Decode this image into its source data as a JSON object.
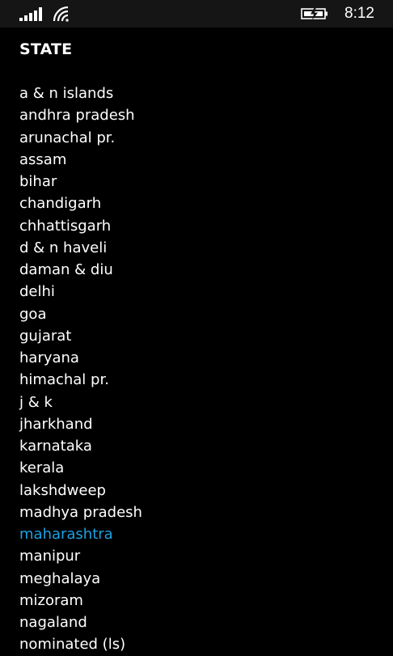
{
  "status_bar": {
    "time": "8:12",
    "signal_icon": "signal-bars-icon",
    "wifi_icon": "wifi-icon",
    "battery_icon": "battery-charging-icon"
  },
  "header": {
    "title": "STATE"
  },
  "colors": {
    "background": "#000000",
    "text": "#ffffff",
    "accent": "#1ba1e2"
  },
  "states": [
    "a & n islands",
    "andhra pradesh",
    "arunachal pr.",
    "assam",
    "bihar",
    "chandigarh",
    "chhattisgarh",
    "d & n haveli",
    "daman & diu",
    "delhi",
    "goa",
    "gujarat",
    "haryana",
    "himachal pr.",
    "j & k",
    "jharkhand",
    "karnataka",
    "kerala",
    "lakshdweep",
    "madhya pradesh",
    "maharashtra",
    "manipur",
    "meghalaya",
    "mizoram",
    "nagaland",
    "nominated (ls)"
  ],
  "selected_state": "maharashtra"
}
